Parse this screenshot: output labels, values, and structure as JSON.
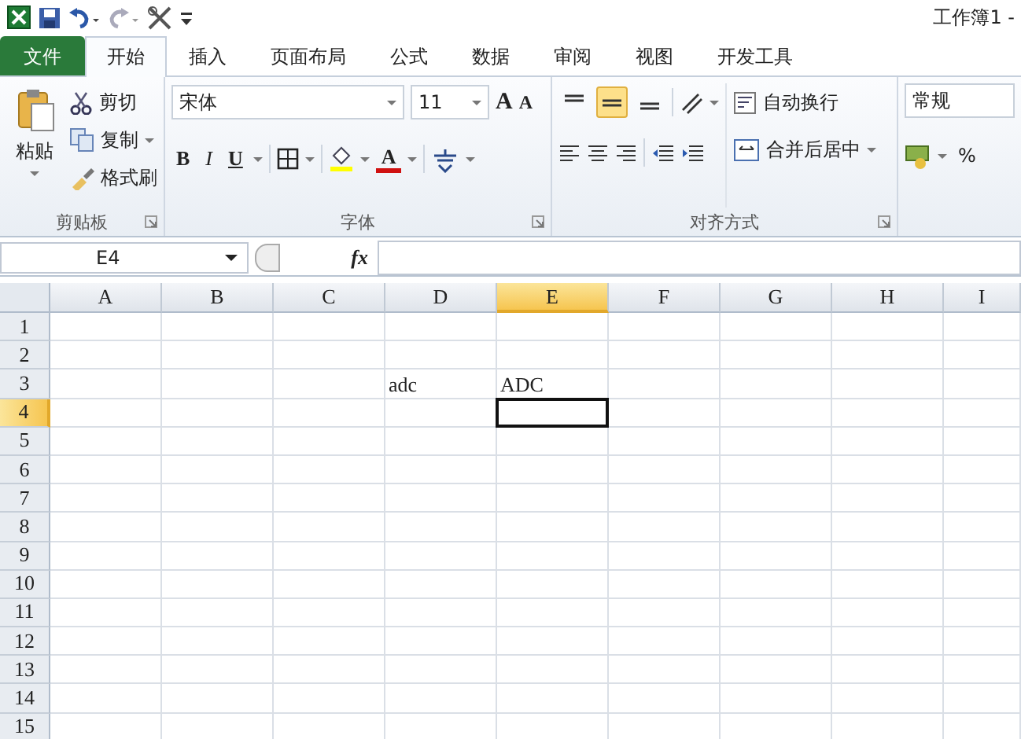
{
  "title_bar": {
    "title": "工作簿1 -"
  },
  "tabs": [
    {
      "label": "文件",
      "kind": "file",
      "selected": false
    },
    {
      "label": "开始",
      "kind": "tab",
      "selected": true
    },
    {
      "label": "插入",
      "kind": "tab",
      "selected": false
    },
    {
      "label": "页面布局",
      "kind": "tab",
      "selected": false
    },
    {
      "label": "公式",
      "kind": "tab",
      "selected": false
    },
    {
      "label": "数据",
      "kind": "tab",
      "selected": false
    },
    {
      "label": "审阅",
      "kind": "tab",
      "selected": false
    },
    {
      "label": "视图",
      "kind": "tab",
      "selected": false
    },
    {
      "label": "开发工具",
      "kind": "tab",
      "selected": false
    }
  ],
  "ribbon": {
    "clipboard": {
      "paste": "粘贴",
      "cut": "剪切",
      "copy": "复制",
      "format_painter": "格式刷",
      "label": "剪贴板"
    },
    "font": {
      "name": "宋体",
      "size": "11",
      "grow": "A",
      "shrink": "A",
      "bold": "B",
      "italic": "I",
      "underline": "U",
      "font_color": "A",
      "label": "字体"
    },
    "alignment": {
      "vertical": [
        {
          "kind": "top",
          "selected": false
        },
        {
          "kind": "middle",
          "selected": true
        },
        {
          "kind": "bottom",
          "selected": false
        }
      ],
      "wrap_text": "自动换行",
      "merge": "合并后居中",
      "label": "对齐方式"
    },
    "number": {
      "format": "常规",
      "percent": "%"
    }
  },
  "formula_bar": {
    "name_box": "E4",
    "fx": "fx"
  },
  "sheet": {
    "columns": [
      {
        "label": "A",
        "selected": false
      },
      {
        "label": "B",
        "selected": false
      },
      {
        "label": "C",
        "selected": false
      },
      {
        "label": "D",
        "selected": false
      },
      {
        "label": "E",
        "selected": true
      },
      {
        "label": "F",
        "selected": false
      },
      {
        "label": "G",
        "selected": false
      },
      {
        "label": "H",
        "selected": false
      },
      {
        "label": "I",
        "selected": false
      }
    ],
    "rows": [
      {
        "label": "1",
        "selected": false,
        "cells": []
      },
      {
        "label": "2",
        "selected": false,
        "cells": []
      },
      {
        "label": "3",
        "selected": false,
        "cells": [
          null,
          null,
          null,
          {
            "text": "adc"
          },
          {
            "text": "ADC"
          }
        ]
      },
      {
        "label": "4",
        "selected": true,
        "cells": [
          null,
          null,
          null,
          null,
          {
            "active": true
          }
        ]
      },
      {
        "label": "5",
        "selected": false,
        "cells": []
      },
      {
        "label": "6",
        "selected": false,
        "cells": []
      },
      {
        "label": "7",
        "selected": false,
        "cells": []
      },
      {
        "label": "8",
        "selected": false,
        "cells": []
      },
      {
        "label": "9",
        "selected": false,
        "cells": []
      },
      {
        "label": "10",
        "selected": false,
        "cells": []
      },
      {
        "label": "11",
        "selected": false,
        "cells": []
      },
      {
        "label": "12",
        "selected": false,
        "cells": []
      },
      {
        "label": "13",
        "selected": false,
        "cells": []
      },
      {
        "label": "14",
        "selected": false,
        "cells": []
      },
      {
        "label": "15",
        "selected": false,
        "cells": []
      }
    ]
  }
}
